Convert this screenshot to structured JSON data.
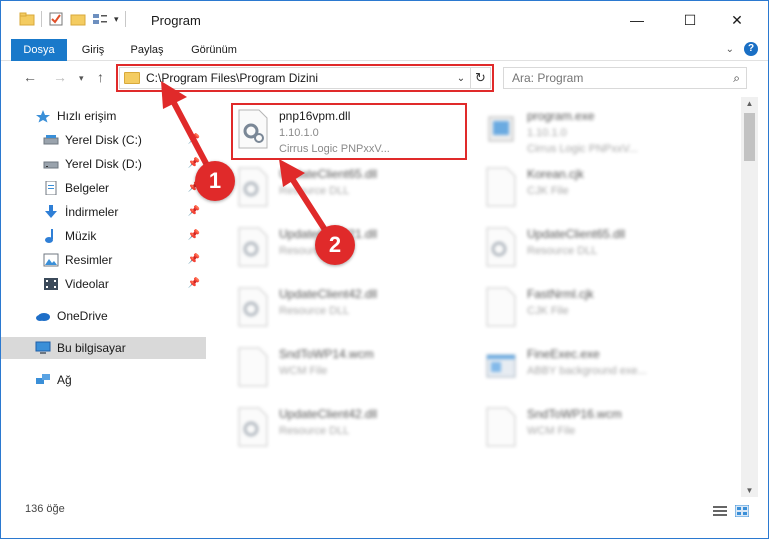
{
  "window": {
    "title": "Program"
  },
  "ribbon": {
    "tabs": [
      {
        "label": "Dosya",
        "active": true
      },
      {
        "label": "Giriş",
        "active": false
      },
      {
        "label": "Paylaş",
        "active": false
      },
      {
        "label": "Görünüm",
        "active": false
      }
    ]
  },
  "address": {
    "path": "C:\\Program Files\\Program Dizini"
  },
  "search": {
    "placeholder": "Ara: Program"
  },
  "sidebar": {
    "items": [
      {
        "label": "Hızlı erişim",
        "icon": "star-icon"
      },
      {
        "label": "Yerel Disk (C:)",
        "icon": "drive-icon",
        "pinned": true
      },
      {
        "label": "Yerel Disk (D:)",
        "icon": "drive-icon",
        "pinned": true
      },
      {
        "label": "Belgeler",
        "icon": "documents-icon",
        "pinned": true
      },
      {
        "label": "İndirmeler",
        "icon": "download-icon",
        "pinned": true
      },
      {
        "label": "Müzik",
        "icon": "music-icon",
        "pinned": true
      },
      {
        "label": "Resimler",
        "icon": "pictures-icon",
        "pinned": true
      },
      {
        "label": "Videolar",
        "icon": "videos-icon",
        "pinned": true
      },
      {
        "label": "OneDrive",
        "icon": "cloud-icon"
      },
      {
        "label": "Bu bilgisayar",
        "icon": "computer-icon",
        "selected": true
      },
      {
        "label": "Ağ",
        "icon": "network-icon"
      }
    ]
  },
  "files": [
    {
      "name": "pnp16vpm.dll",
      "line1": "1.10.1.0",
      "line2": "Cirrus Logic PNPxxV...",
      "type": "dll",
      "highlighted": true
    },
    {
      "name": "program.exe",
      "line1": "1.10.1.0",
      "line2": "Cirrus Logic PNPxxV...",
      "type": "exe"
    },
    {
      "name": "UpdateClient65.dll",
      "line1": "Resource DLL",
      "line2": "",
      "type": "dll"
    },
    {
      "name": "Korean.cjk",
      "line1": "CJK File",
      "line2": "",
      "type": "file"
    },
    {
      "name": "UpdateClient21.dll",
      "line1": "Resource DLL",
      "line2": "",
      "type": "dll"
    },
    {
      "name": "UpdateClient65.dll",
      "line1": "Resource DLL",
      "line2": "",
      "type": "dll"
    },
    {
      "name": "UpdateClient42.dll",
      "line1": "Resource DLL",
      "line2": "",
      "type": "dll"
    },
    {
      "name": "FastNrml.cjk",
      "line1": "CJK File",
      "line2": "",
      "type": "file"
    },
    {
      "name": "SndToWP14.wcm",
      "line1": "WCM File",
      "line2": "",
      "type": "file"
    },
    {
      "name": "FineExec.exe",
      "line1": "ABBY background exe...",
      "line2": "",
      "type": "app"
    },
    {
      "name": "UpdateClient42.dll",
      "line1": "Resource DLL",
      "line2": "",
      "type": "dll"
    },
    {
      "name": "SndToWP16.wcm",
      "line1": "WCM File",
      "line2": "",
      "type": "file"
    }
  ],
  "status": {
    "count": "136 öğe"
  },
  "annotations": {
    "step1": "1",
    "step2": "2",
    "color": "#e02a2a"
  }
}
